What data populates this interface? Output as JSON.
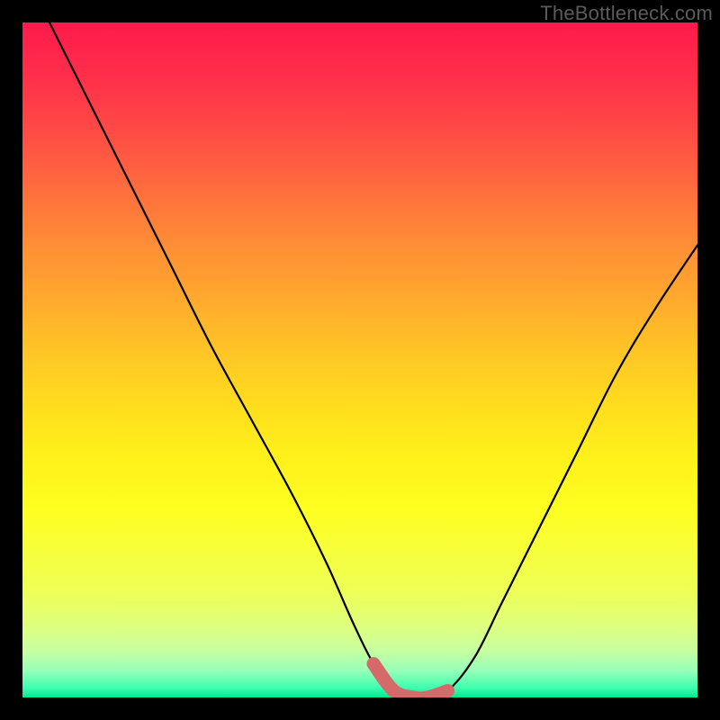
{
  "watermark": "TheBottleneck.com",
  "chart_data": {
    "type": "line",
    "title": "",
    "xlabel": "",
    "ylabel": "",
    "xlim": [
      0,
      100
    ],
    "ylim": [
      0,
      100
    ],
    "series": [
      {
        "name": "bottleneck-curve",
        "x": [
          4,
          10,
          16,
          22,
          28,
          34,
          40,
          45,
          49,
          52,
          55,
          58,
          60,
          63,
          67,
          71,
          76,
          82,
          88,
          94,
          100
        ],
        "values": [
          100,
          88,
          76,
          64,
          52,
          41,
          30,
          20,
          11,
          5,
          1,
          0,
          0,
          1,
          6,
          14,
          24,
          36,
          48,
          58,
          67
        ]
      }
    ],
    "highlight": {
      "name": "optimal-zone",
      "x": [
        52,
        55,
        58,
        60,
        63
      ],
      "values": [
        5,
        1,
        0,
        0,
        1
      ],
      "color": "#d46a6a"
    },
    "gradient_stops": [
      {
        "pct": 0,
        "color": "#ff1a4d"
      },
      {
        "pct": 50,
        "color": "#ffcf22"
      },
      {
        "pct": 90,
        "color": "#f0ff50"
      },
      {
        "pct": 100,
        "color": "#00e890"
      }
    ]
  }
}
